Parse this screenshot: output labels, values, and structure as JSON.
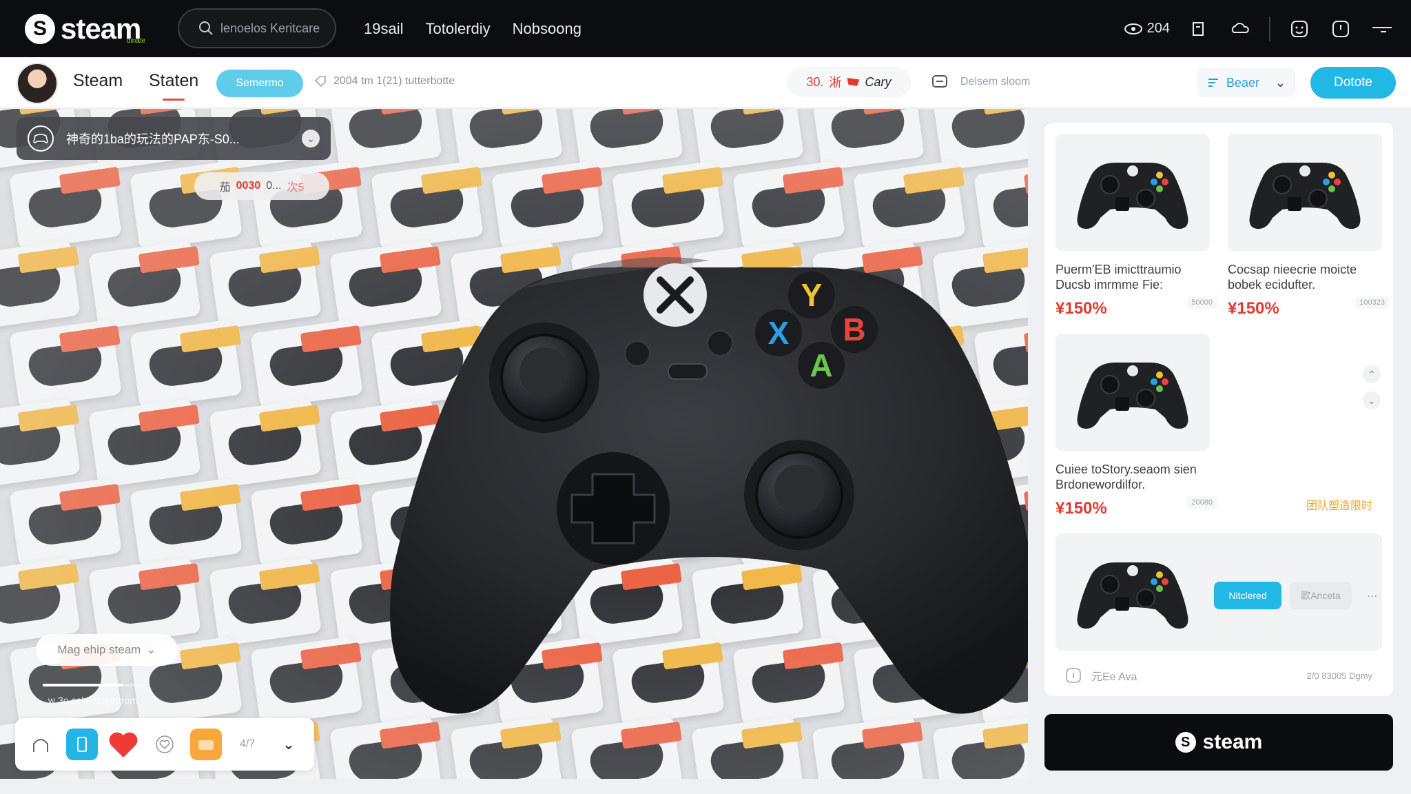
{
  "header": {
    "logo_text": "steam",
    "logo_sub": "dinate",
    "search_placeholder": "lenoelos Keritcare",
    "nav": [
      "19sail",
      "Totolerdiy",
      "Nobsoong"
    ],
    "counter": "204"
  },
  "subbar": {
    "tab_1": "Steam",
    "tab_2": "Staten",
    "chip": "Semermo",
    "meta": "2004 tm 1(21) tutterbotte",
    "price_value": "30.",
    "price_symbol": "淅",
    "price_label": "Cary",
    "steam_search": "Delsem sloom",
    "sort_label": "Beaer",
    "donate": "Dotote"
  },
  "hero": {
    "notification": "神奇的1ba的玩法的PAP东-S0...",
    "timer_icon": "茄",
    "timer_value": "0030",
    "timer_sep": "0...",
    "timer_tail": "次5",
    "caption_pill": "Mag ehip steam",
    "hint": "w 3o.selemmgettrom",
    "progress": 0.78,
    "action_count": "4/7",
    "controller": {
      "buttons": [
        "Y",
        "X",
        "B",
        "A"
      ],
      "colors": {
        "Y": "#f2c230",
        "X": "#2a9fe3",
        "B": "#e8443a",
        "A": "#6ac64a"
      }
    }
  },
  "products": [
    {
      "name": "Puerm'EB imicttraumio Ducsb imrmme Fie:",
      "price": "¥150%",
      "tag": "50000"
    },
    {
      "name": "Cocsap nieecrie moicte bobek ecidufter.",
      "price": "¥150%",
      "tag": "100323"
    },
    {
      "name": "Cuiee toStory.seaom sien Brdonewordilfor.",
      "price": "¥150%",
      "tag": "20080"
    }
  ],
  "third_card_orange": "团队塑造限时",
  "bottom_card": {
    "primary_btn": "Nitclered",
    "ghost_btn": "歐Anceta",
    "more": "..."
  },
  "panel_footer": {
    "left": "元Ee Ava",
    "right": "2/0 83005 Dgmy"
  },
  "steam_button": "steam",
  "colors": {
    "accent": "#22b8e6",
    "price_red": "#e23a2f",
    "dark": "#0c0d10"
  }
}
